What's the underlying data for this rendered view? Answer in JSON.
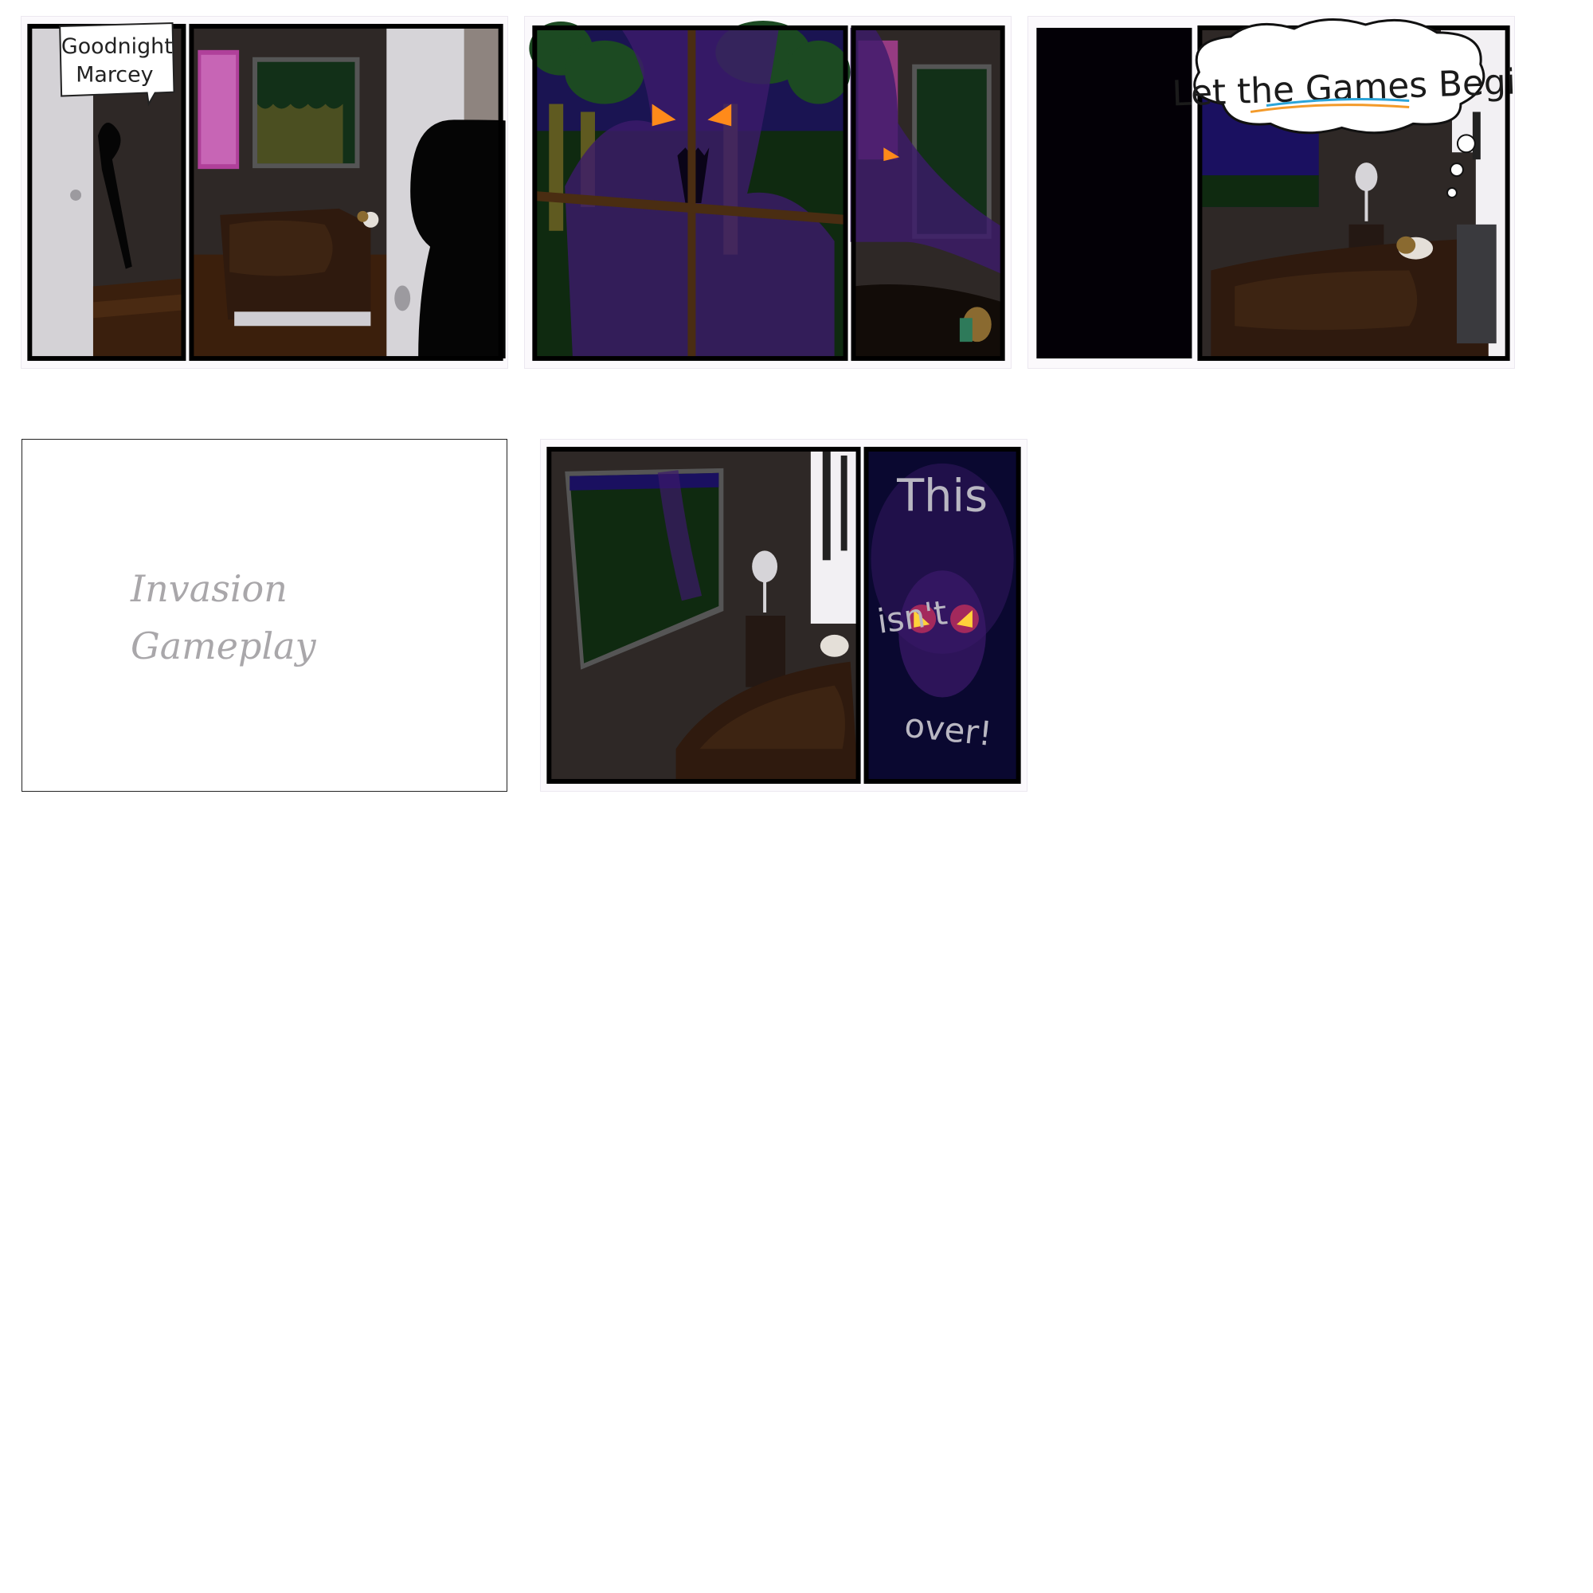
{
  "strips": [
    {
      "id": "strip-1",
      "speech_bubble": [
        "Goodnight",
        "Marcey"
      ]
    },
    {
      "id": "strip-2"
    },
    {
      "id": "strip-3",
      "thought_bubble": "Let the Games Begin"
    },
    {
      "id": "strip-5",
      "caption": [
        "This",
        "isn't",
        "over!"
      ]
    }
  ],
  "placeholder": {
    "lines": [
      "Invasion",
      "Gameplay"
    ]
  },
  "colors": {
    "room_wall": "#2e2826",
    "night_sky": "#1a1060",
    "forest": "#0f2a10",
    "shadow_creature": "#3c1a6b",
    "glow_eyes": "#ff8a1a",
    "bed": "#2f1a0e"
  }
}
